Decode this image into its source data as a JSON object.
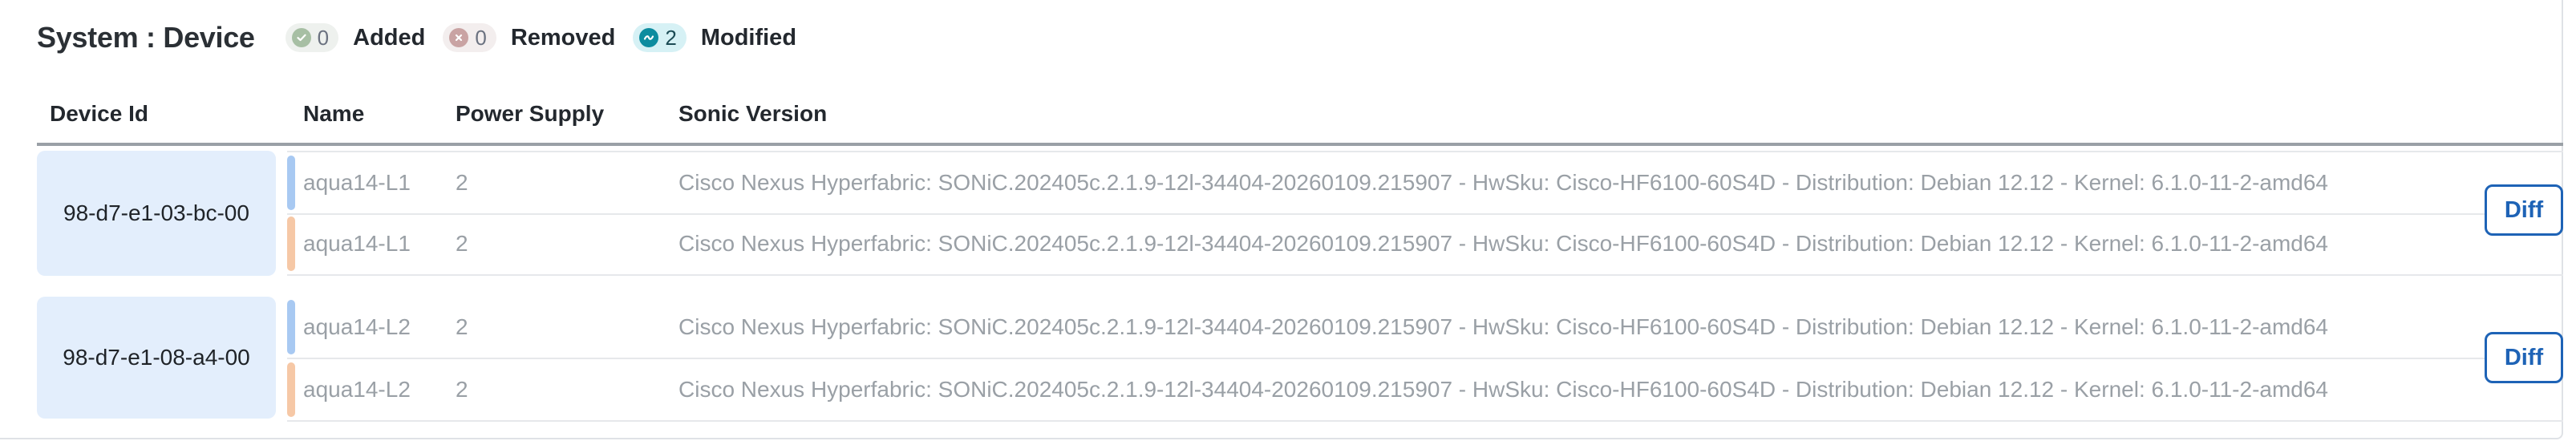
{
  "header": {
    "title": "System : Device",
    "added": {
      "count": "0",
      "label": "Added"
    },
    "removed": {
      "count": "0",
      "label": "Removed"
    },
    "modified": {
      "count": "2",
      "label": "Modified"
    }
  },
  "table": {
    "columns": {
      "device_id": "Device Id",
      "name": "Name",
      "power_supply": "Power Supply",
      "sonic_version": "Sonic Version"
    },
    "groups": [
      {
        "device_id": "98-d7-e1-03-bc-00",
        "diff_label": "Diff",
        "rows": [
          {
            "name": "aqua14-L1",
            "power_supply": "2",
            "sonic_version": "Cisco Nexus Hyperfabric: SONiC.202405c.2.1.9-12l-34404-20260109.215907 - HwSku: Cisco-HF6100-60S4D - Distribution: Debian 12.12 - Kernel: 6.1.0-11-2-amd64"
          },
          {
            "name": "aqua14-L1",
            "power_supply": "2",
            "sonic_version": "Cisco Nexus Hyperfabric: SONiC.202405c.2.1.9-12l-34404-20260109.215907 - HwSku: Cisco-HF6100-60S4D - Distribution: Debian 12.12 - Kernel: 6.1.0-11-2-amd64"
          }
        ]
      },
      {
        "device_id": "98-d7-e1-08-a4-00",
        "diff_label": "Diff",
        "rows": [
          {
            "name": "aqua14-L2",
            "power_supply": "2",
            "sonic_version": "Cisco Nexus Hyperfabric: SONiC.202405c.2.1.9-12l-34404-20260109.215907 - HwSku: Cisco-HF6100-60S4D - Distribution: Debian 12.12 - Kernel: 6.1.0-11-2-amd64"
          },
          {
            "name": "aqua14-L2",
            "power_supply": "2",
            "sonic_version": "Cisco Nexus Hyperfabric: SONiC.202405c.2.1.9-12l-34404-20260109.215907 - HwSku: Cisco-HF6100-60S4D - Distribution: Debian 12.12 - Kernel: 6.1.0-11-2-amd64"
          }
        ]
      }
    ]
  },
  "colors": {
    "old_row_marker": "#a8c9f2",
    "new_row_marker": "#f6c8a6",
    "device_cell_bg": "#e3eefc",
    "accent": "#1e63b6",
    "modified_badge": "#0d8c9f"
  },
  "icons": {
    "added": "check-circle-icon",
    "removed": "x-circle-icon",
    "modified": "tilde-circle-icon"
  }
}
